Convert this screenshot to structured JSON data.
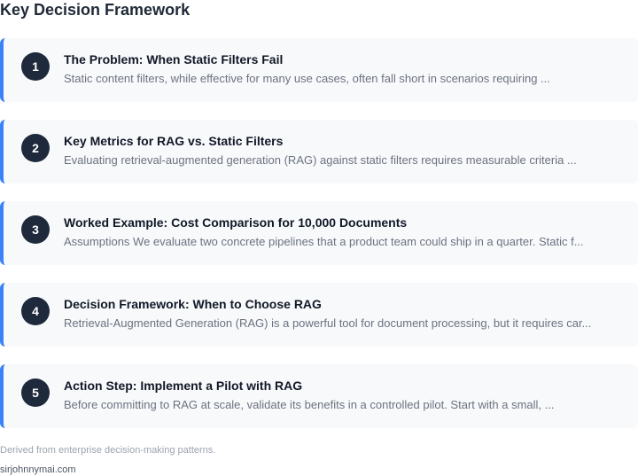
{
  "header": {
    "title": "Key Decision Framework"
  },
  "steps": [
    {
      "number": "1",
      "title": "The Problem: When Static Filters Fail",
      "summary": "Static content filters, while effective for many use cases, often fall short in scenarios requiring ..."
    },
    {
      "number": "2",
      "title": "Key Metrics for RAG vs. Static Filters",
      "summary": "Evaluating retrieval-augmented generation (RAG) against static filters requires measurable criteria ..."
    },
    {
      "number": "3",
      "title": "Worked Example: Cost Comparison for 10,000 Documents",
      "summary": "Assumptions We evaluate two concrete pipelines that a product team could ship in a quarter. Static f..."
    },
    {
      "number": "4",
      "title": "Decision Framework: When to Choose RAG",
      "summary": "Retrieval-Augmented Generation (RAG) is a powerful tool for document processing, but it requires car..."
    },
    {
      "number": "5",
      "title": "Action Step: Implement a Pilot with RAG",
      "summary": "Before committing to RAG at scale, validate its benefits in a controlled pilot. Start with a small, ..."
    }
  ],
  "footer": {
    "source_note": "Derived from enterprise decision-making patterns.",
    "site": "sirjohnnymai.com"
  },
  "colors": {
    "accent": "#3b82f6",
    "number_badge": "#1e293b",
    "card_background": "#f8f9fb"
  }
}
